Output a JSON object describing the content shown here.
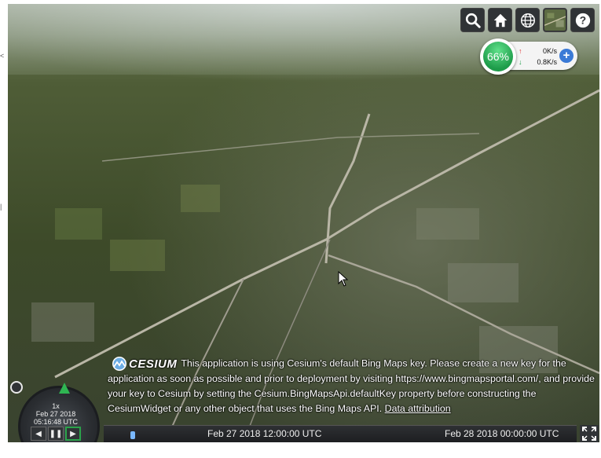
{
  "toolbar": {
    "buttons": [
      "search-icon",
      "home-icon",
      "globe-icon",
      "imagery-layer-icon",
      "help-icon"
    ]
  },
  "performance": {
    "percent": "66%",
    "upload": "0K/s",
    "download": "0.8K/s",
    "colors": {
      "ring": "#1e9c4a",
      "plus": "#3b7ad6"
    }
  },
  "credits": {
    "logo_text": "CESIUM",
    "message": "This application is using Cesium's default Bing Maps key. Please create a new key for the application as soon as possible and prior to deployment by visiting https://www.bingmapsportal.com/, and provide your key to Cesium by setting the Cesium.BingMapsApi.defaultKey property before constructing the CesiumWidget or any other object that uses the Bing Maps API.",
    "link": "Data attribution"
  },
  "animation": {
    "speed": "1x",
    "date": "Feb 27 2018",
    "time": "05:16:48 UTC",
    "buttons": [
      "rewind-icon",
      "pause-icon",
      "play-icon"
    ]
  },
  "timeline": {
    "label_1": "Feb 27 2018 12:00:00 UTC",
    "label_2": "Feb 28 2018 00:00:00 UTC"
  }
}
